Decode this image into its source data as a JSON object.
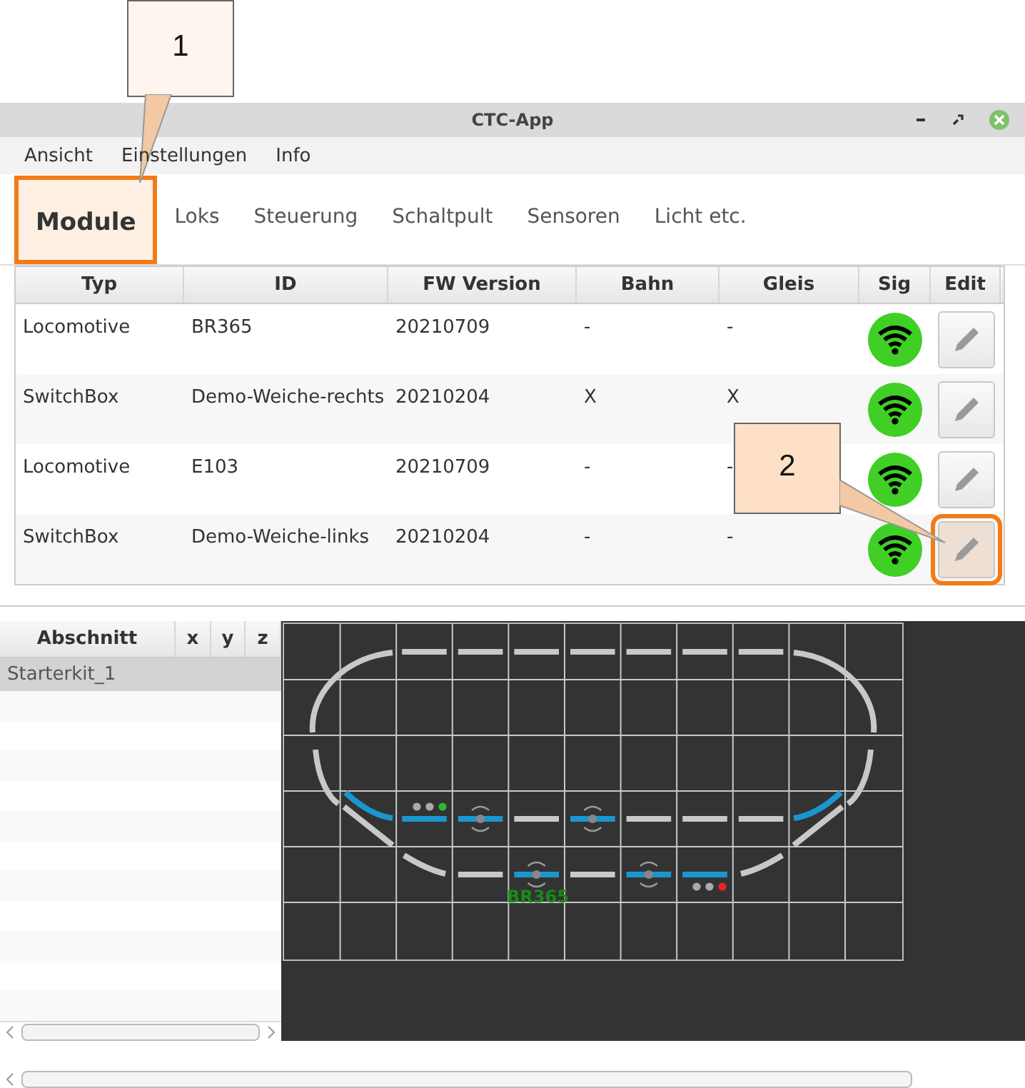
{
  "window": {
    "title": "CTC-App"
  },
  "menu": [
    "Ansicht",
    "Einstellungen",
    "Info"
  ],
  "tabs": [
    {
      "label": "Module",
      "selected": true,
      "highlighted": true
    },
    {
      "label": "Loks",
      "selected": false,
      "highlighted": false
    },
    {
      "label": "Steuerung",
      "selected": false,
      "highlighted": false
    },
    {
      "label": "Schaltpult",
      "selected": false,
      "highlighted": false
    },
    {
      "label": "Sensoren",
      "selected": false,
      "highlighted": false
    },
    {
      "label": "Licht etc.",
      "selected": false,
      "highlighted": false
    }
  ],
  "table": {
    "columns": [
      "Typ",
      "ID",
      "FW Version",
      "Bahn",
      "Gleis",
      "Sig",
      "Edit"
    ],
    "rows": [
      {
        "cells": [
          "Locomotive",
          "BR365",
          "20210709",
          "-",
          "-"
        ],
        "edit_highlighted": false
      },
      {
        "cells": [
          "SwitchBox",
          "Demo-Weiche-rechts",
          "20210204",
          "X",
          "X"
        ],
        "edit_highlighted": false
      },
      {
        "cells": [
          "Locomotive",
          "E103",
          "20210709",
          "-",
          "-"
        ],
        "edit_highlighted": false
      },
      {
        "cells": [
          "SwitchBox",
          "Demo-Weiche-links",
          "20210204",
          "-",
          "-"
        ],
        "edit_highlighted": true
      }
    ]
  },
  "sections": {
    "columns": [
      "Abschnitt",
      "x",
      "y",
      "z"
    ],
    "rows": [
      {
        "name": "Starterkit_1",
        "selected": true
      }
    ]
  },
  "layout": {
    "loco_label": "BR365"
  },
  "callouts": [
    {
      "label": "1"
    },
    {
      "label": "2"
    }
  ]
}
